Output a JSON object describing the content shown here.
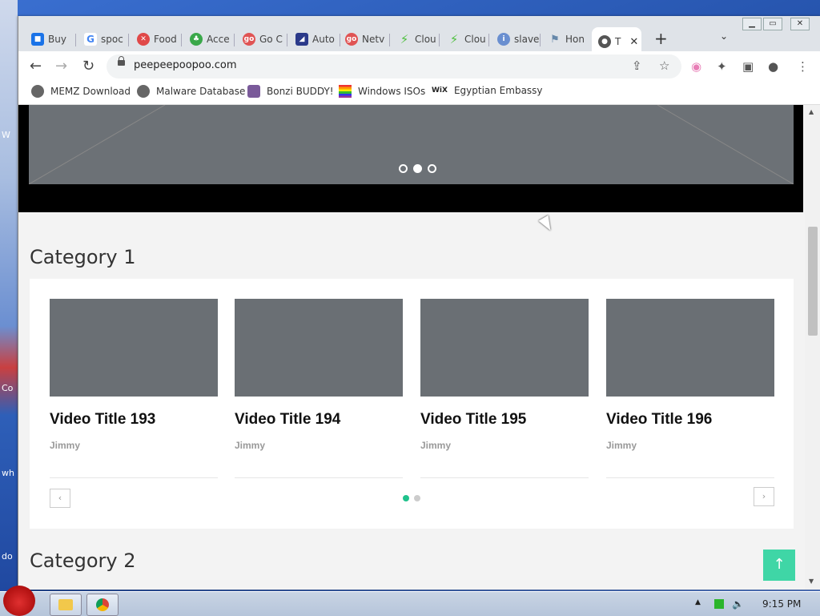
{
  "browser": {
    "tabs": [
      {
        "label": "Buy",
        "icon": "store-icon",
        "color": "#1a73e8"
      },
      {
        "label": "spoc",
        "icon": "google-icon",
        "color": "#ea4335"
      },
      {
        "label": "Food",
        "icon": "close-x-icon",
        "color": "#e04848"
      },
      {
        "label": "Acce",
        "icon": "clover-icon",
        "color": "#3aa84a"
      },
      {
        "label": "Go C",
        "icon": "go-icon",
        "color": "#e05454"
      },
      {
        "label": "Auto",
        "icon": "auto-icon",
        "color": "#2b3a8a"
      },
      {
        "label": "Netv",
        "icon": "go-icon",
        "color": "#e05454"
      },
      {
        "label": "Clou",
        "icon": "bolt-icon",
        "color": "#4cbf3c"
      },
      {
        "label": "Clou",
        "icon": "bolt-icon",
        "color": "#4cbf3c"
      },
      {
        "label": "slave",
        "icon": "info-icon",
        "color": "#6a8fd0"
      },
      {
        "label": "Hon",
        "icon": "flag-icon",
        "color": "#6688aa"
      },
      {
        "label": "T",
        "icon": "globe-icon",
        "color": "#555555"
      }
    ],
    "new_tab": "+",
    "tab_menu": "⌄",
    "url": "peepeepoopoo.com",
    "bookmarks": [
      {
        "label": "MEMZ Download",
        "icon": "globe-icon"
      },
      {
        "label": "Malware Database",
        "icon": "globe-icon"
      },
      {
        "label": "Bonzi BUDDY!",
        "icon": "bonzi-icon"
      },
      {
        "label": "Windows ISOs",
        "icon": "rainbow-flag-icon"
      },
      {
        "label": "Egyptian Embassy",
        "icon": "wix-icon",
        "icon_text": "WiX"
      }
    ]
  },
  "page": {
    "categories": [
      {
        "title": "Category 1",
        "videos": [
          {
            "title": "Video Title 193",
            "author": "Jimmy"
          },
          {
            "title": "Video Title 194",
            "author": "Jimmy"
          },
          {
            "title": "Video Title 195",
            "author": "Jimmy"
          },
          {
            "title": "Video Title 196",
            "author": "Jimmy"
          }
        ],
        "prev": "‹",
        "next": "›",
        "page_dots": 2,
        "active_dot": 1
      },
      {
        "title": "Category 2"
      }
    ],
    "hero_dots": 3,
    "hero_active": 2,
    "back_to_top": "↑",
    "accent": "#20c28c"
  },
  "desktop_labels": [
    "W",
    "Co",
    "wh",
    "do"
  ],
  "taskbar": {
    "time": "9:15 PM"
  }
}
